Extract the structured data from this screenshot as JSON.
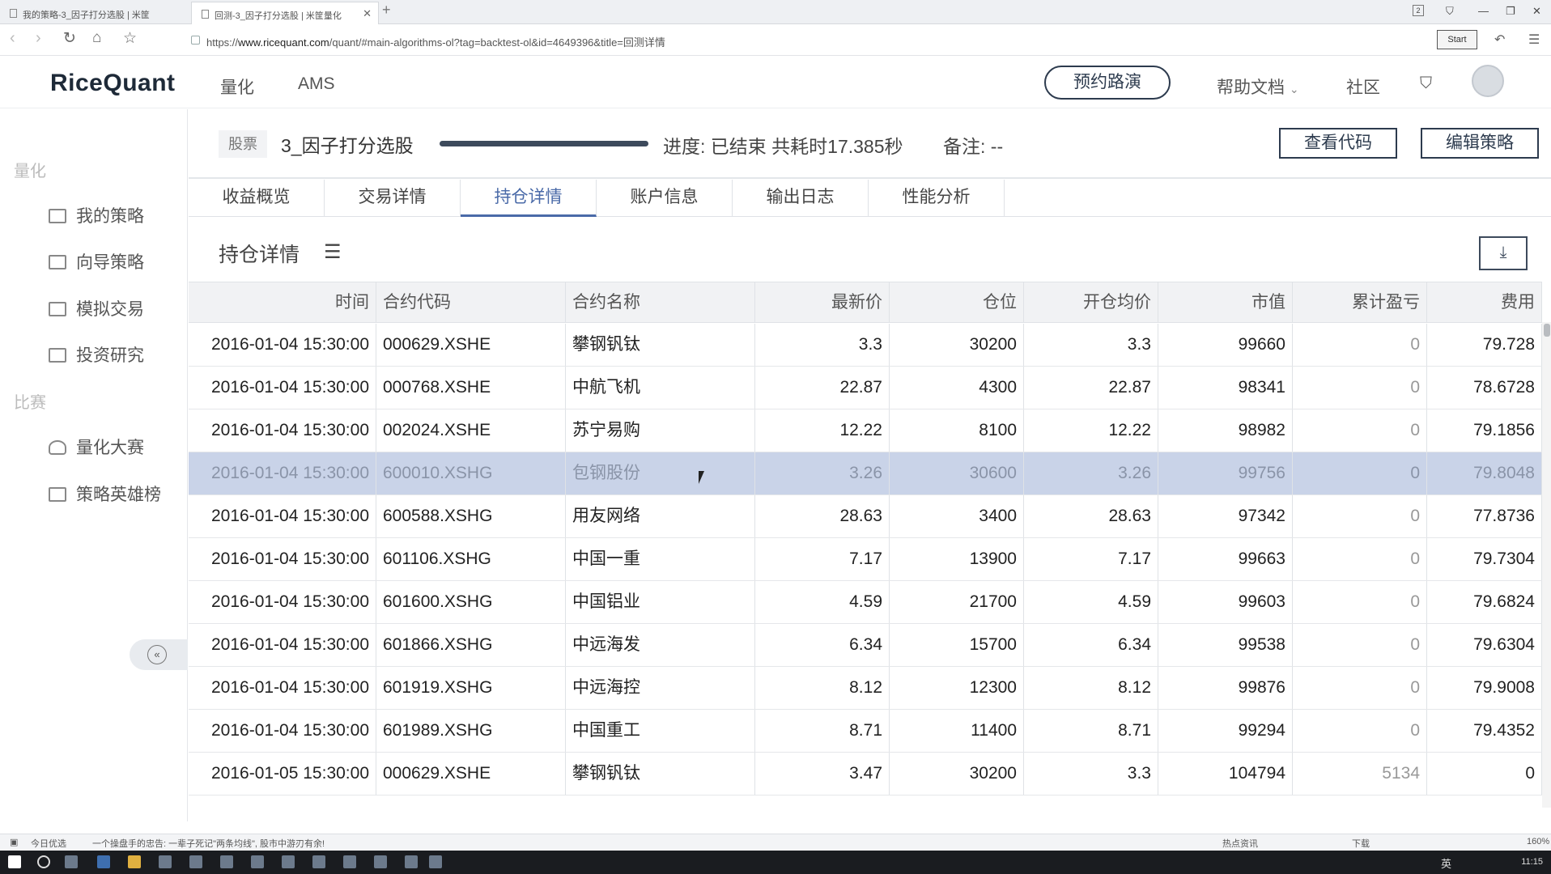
{
  "browser": {
    "tabs": [
      {
        "title": "我的策略-3_因子打分选股 | 米筐",
        "active": false
      },
      {
        "title": "回测-3_因子打分选股 | 米筐量化",
        "active": true
      }
    ],
    "new_tab": "+",
    "url_prefix": "https://",
    "url_domain": "www.ricequant.com",
    "url_path": "/quant/#main-algorithms-ol?tag=backtest-ol&id=4649396&title=回测详情",
    "badge": "2",
    "start_label": "Start"
  },
  "header": {
    "logo": "RiceQuant",
    "nav": [
      "量化",
      "AMS"
    ],
    "demo_button": "预约路演",
    "docs": "帮助文档",
    "community": "社区"
  },
  "sidebar": {
    "sections": [
      {
        "title": "量化",
        "items": [
          {
            "label": "我的策略",
            "icon": "chart-line-icon"
          },
          {
            "label": "向导策略",
            "icon": "wizard-icon"
          },
          {
            "label": "模拟交易",
            "icon": "trade-icon"
          },
          {
            "label": "投资研究",
            "icon": "research-icon"
          }
        ]
      },
      {
        "title": "比赛",
        "items": [
          {
            "label": "量化大赛",
            "icon": "trophy-icon"
          },
          {
            "label": "策略英雄榜",
            "icon": "leaderboard-icon"
          }
        ]
      }
    ],
    "collapse": "«"
  },
  "strategy": {
    "type_tag": "股票",
    "name": "3_因子打分选股",
    "progress": 1.0,
    "progress_text": "进度: 已结束 共耗时17.385秒",
    "remark": "备注: --",
    "view_code": "查看代码",
    "edit_strategy": "编辑策略"
  },
  "tabs": [
    "收益概览",
    "交易详情",
    "持仓详情",
    "账户信息",
    "输出日志",
    "性能分析"
  ],
  "active_tab": 2,
  "section": {
    "title": "持仓详情",
    "list_icon": "☰",
    "download_icon": "⤓"
  },
  "table": {
    "columns": [
      "时间",
      "合约代码",
      "合约名称",
      "最新价",
      "仓位",
      "开仓均价",
      "市值",
      "累计盈亏",
      "费用"
    ],
    "rows": [
      [
        "2016-01-04 15:30:00",
        "000629.XSHE",
        "攀钢钒钛",
        "3.3",
        "30200",
        "3.3",
        "99660",
        "0",
        "79.728"
      ],
      [
        "2016-01-04 15:30:00",
        "000768.XSHE",
        "中航飞机",
        "22.87",
        "4300",
        "22.87",
        "98341",
        "0",
        "78.6728"
      ],
      [
        "2016-01-04 15:30:00",
        "002024.XSHE",
        "苏宁易购",
        "12.22",
        "8100",
        "12.22",
        "98982",
        "0",
        "79.1856"
      ],
      [
        "2016-01-04 15:30:00",
        "600010.XSHG",
        "包钢股份",
        "3.26",
        "30600",
        "3.26",
        "99756",
        "0",
        "79.8048"
      ],
      [
        "2016-01-04 15:30:00",
        "600588.XSHG",
        "用友网络",
        "28.63",
        "3400",
        "28.63",
        "97342",
        "0",
        "77.8736"
      ],
      [
        "2016-01-04 15:30:00",
        "601106.XSHG",
        "中国一重",
        "7.17",
        "13900",
        "7.17",
        "99663",
        "0",
        "79.7304"
      ],
      [
        "2016-01-04 15:30:00",
        "601600.XSHG",
        "中国铝业",
        "4.59",
        "21700",
        "4.59",
        "99603",
        "0",
        "79.6824"
      ],
      [
        "2016-01-04 15:30:00",
        "601866.XSHG",
        "中远海发",
        "6.34",
        "15700",
        "6.34",
        "99538",
        "0",
        "79.6304"
      ],
      [
        "2016-01-04 15:30:00",
        "601919.XSHG",
        "中远海控",
        "8.12",
        "12300",
        "8.12",
        "99876",
        "0",
        "79.9008"
      ],
      [
        "2016-01-04 15:30:00",
        "601989.XSHG",
        "中国重工",
        "8.71",
        "11400",
        "8.71",
        "99294",
        "0",
        "79.4352"
      ],
      [
        "2016-01-05 15:30:00",
        "000629.XSHE",
        "攀钢钒钛",
        "3.47",
        "30200",
        "3.3",
        "104794",
        "5134",
        "0"
      ]
    ],
    "highlighted_row": 3
  },
  "statusbar": {
    "left": "今日优选",
    "news": "一个操盘手的忠告: 一辈子死记\"两条均线\", 股市中游刃有余!",
    "hot": "热点资讯",
    "download": "下载",
    "zoom": "160%"
  },
  "taskbar": {
    "lang": "英",
    "time": "11:15"
  },
  "colors": {
    "accent": "#4a6aa8",
    "highlight_row": "#c9d3e8",
    "dark": "#2d3b4e"
  }
}
